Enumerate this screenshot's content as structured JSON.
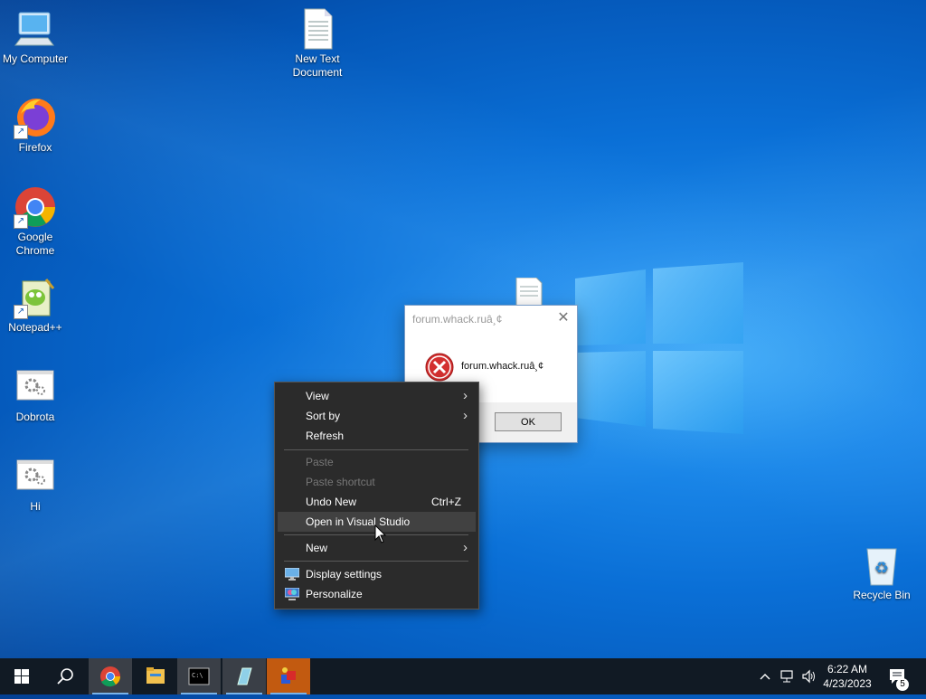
{
  "desktop": {
    "icons": [
      {
        "label": "My Computer",
        "icon": "computer-icon"
      },
      {
        "label": "New Text Document",
        "icon": "text-file-icon"
      },
      {
        "label": "Firefox",
        "icon": "firefox-icon"
      },
      {
        "label": "Google Chrome",
        "icon": "chrome-icon"
      },
      {
        "label": "Notepad++",
        "icon": "notepadpp-icon"
      },
      {
        "label": "Dobrota",
        "icon": "settings-file-icon"
      },
      {
        "label": "Hi",
        "icon": "settings-file-icon"
      },
      {
        "label": "Recycle Bin",
        "icon": "recycle-bin-icon"
      }
    ]
  },
  "dialog": {
    "title": "forum.whack.ruâ¸¢",
    "message": "forum.whack.ruâ¸¢",
    "ok_label": "OK",
    "close_glyph": "✕"
  },
  "context_menu": {
    "items": [
      {
        "label": "View",
        "submenu": true
      },
      {
        "label": "Sort by",
        "submenu": true
      },
      {
        "label": "Refresh"
      },
      {
        "label": "Paste",
        "disabled": true
      },
      {
        "label": "Paste shortcut",
        "disabled": true
      },
      {
        "label": "Undo New",
        "shortcut": "Ctrl+Z"
      },
      {
        "label": "Open in Visual Studio",
        "highlighted": true
      },
      {
        "label": "New",
        "submenu": true
      },
      {
        "label": "Display settings",
        "icon": "display-icon"
      },
      {
        "label": "Personalize",
        "icon": "personalize-icon"
      }
    ]
  },
  "taskbar": {
    "buttons": [
      "start-icon",
      "search-icon",
      "chrome-icon",
      "file-explorer-icon",
      "cmd-icon",
      "notepad-icon",
      "app-icon"
    ],
    "clock_time": "6:22 AM",
    "clock_date": "4/23/2023",
    "notification_count": "5"
  },
  "colors": {
    "menu_bg": "#2b2b2b",
    "taskbar_bg": "#111a24",
    "accent": "#0a6fd6"
  }
}
